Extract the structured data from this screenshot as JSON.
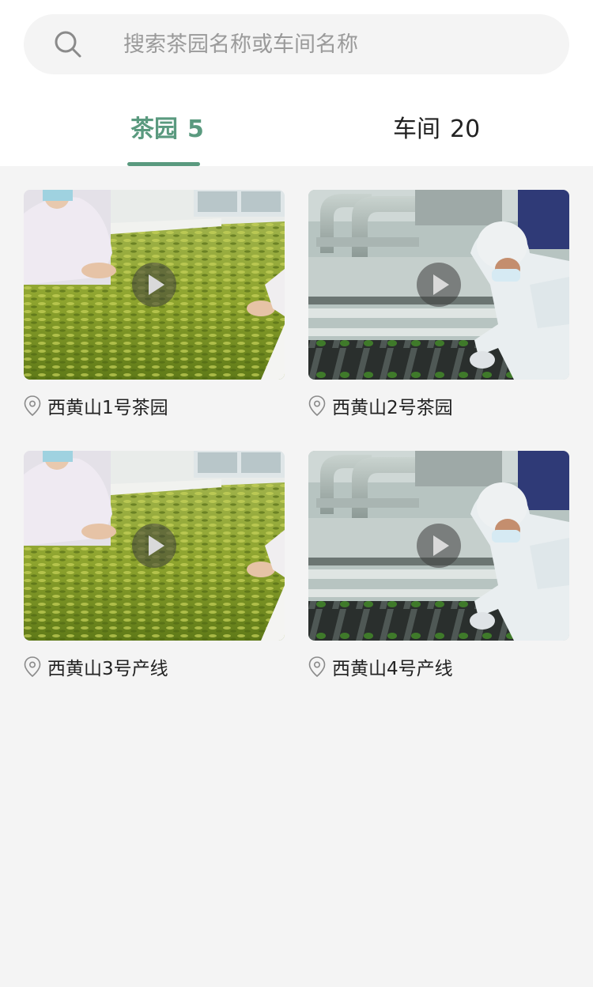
{
  "search": {
    "placeholder": "搜索茶园名称或车间名称",
    "value": ""
  },
  "tabs": [
    {
      "label": "茶园",
      "count": "5",
      "active": true
    },
    {
      "label": "车间",
      "count": "20",
      "active": false
    }
  ],
  "colors": {
    "accent": "#5a9a7f",
    "background": "#f4f4f4"
  },
  "cards": [
    {
      "title": "西黄山1号茶园",
      "image": "tea-withering-photo",
      "icon": "location-pin-icon"
    },
    {
      "title": "西黄山2号茶园",
      "image": "tea-machine-photo",
      "icon": "location-pin-icon"
    },
    {
      "title": "西黄山3号产线",
      "image": "tea-withering-photo",
      "icon": "location-pin-icon"
    },
    {
      "title": "西黄山4号产线",
      "image": "tea-machine-photo",
      "icon": "location-pin-icon"
    }
  ]
}
